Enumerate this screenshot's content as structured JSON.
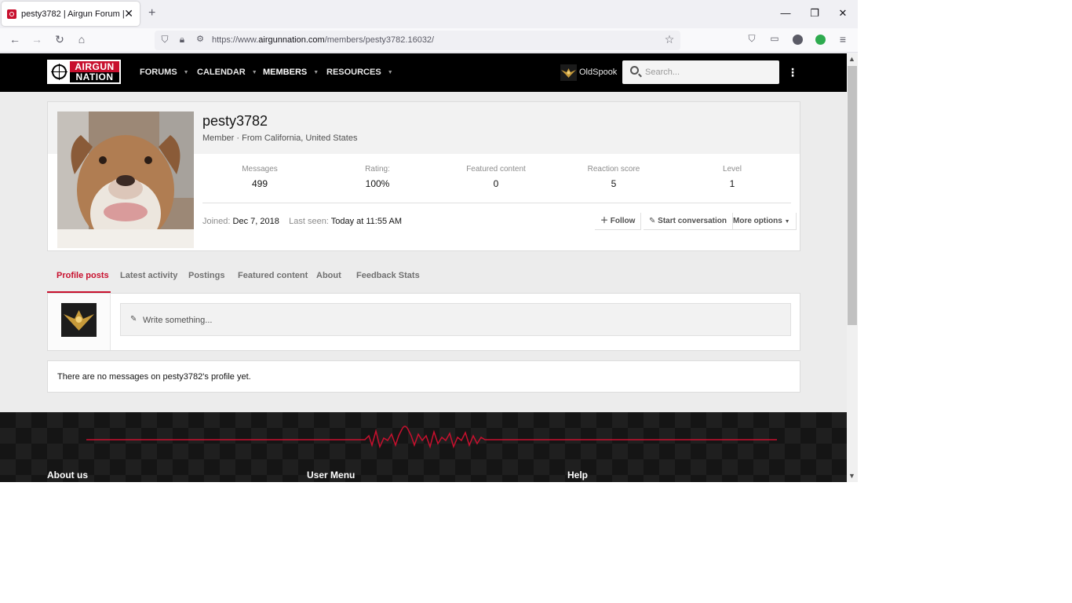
{
  "browser": {
    "tab_title": "pesty3782 | Airgun Forum | Airg",
    "url_prefix": "https://www.",
    "url_host": "airgunnation.com",
    "url_path": "/members/pesty3782.16032/",
    "new_tab": "+",
    "close": "✕"
  },
  "site": {
    "logo_top": "AIRGUN",
    "logo_bottom": "NATION",
    "nav": [
      {
        "label": "FORUMS"
      },
      {
        "label": "CALENDAR"
      },
      {
        "label": "MEMBERS"
      },
      {
        "label": "RESOURCES"
      }
    ],
    "active_nav": "MEMBERS",
    "user_name": "OldSpook",
    "search_placeholder": "Search..."
  },
  "profile": {
    "name": "pesty3782",
    "subtitle": "Member · From California, United States",
    "stats": [
      {
        "label": "Messages",
        "value": "499"
      },
      {
        "label": "Rating:",
        "value": "100%"
      },
      {
        "label": "Featured content",
        "value": "0"
      },
      {
        "label": "Reaction score",
        "value": "5"
      },
      {
        "label": "Level",
        "value": "1"
      }
    ],
    "joined_label": "Joined:",
    "joined_value": "Dec 7, 2018",
    "last_seen_label": "Last seen:",
    "last_seen_value": "Today at 11:55 AM",
    "actions": {
      "follow": "Follow",
      "start_conversation": "Start conversation",
      "more_options": "More options"
    }
  },
  "tabs": [
    {
      "label": "Profile posts"
    },
    {
      "label": "Latest activity"
    },
    {
      "label": "Postings"
    },
    {
      "label": "Featured content"
    },
    {
      "label": "About"
    },
    {
      "label": "Feedback Stats"
    }
  ],
  "active_tab": "Profile posts",
  "post_box": {
    "placeholder": "Write something..."
  },
  "empty_message": "There are no messages on pesty3782's profile yet.",
  "footer": {
    "headings": [
      "About us",
      "User Menu",
      "Help"
    ]
  },
  "colors": {
    "brand_red": "#c8102e",
    "header_bg": "#000000",
    "page_bg": "#ececec"
  }
}
